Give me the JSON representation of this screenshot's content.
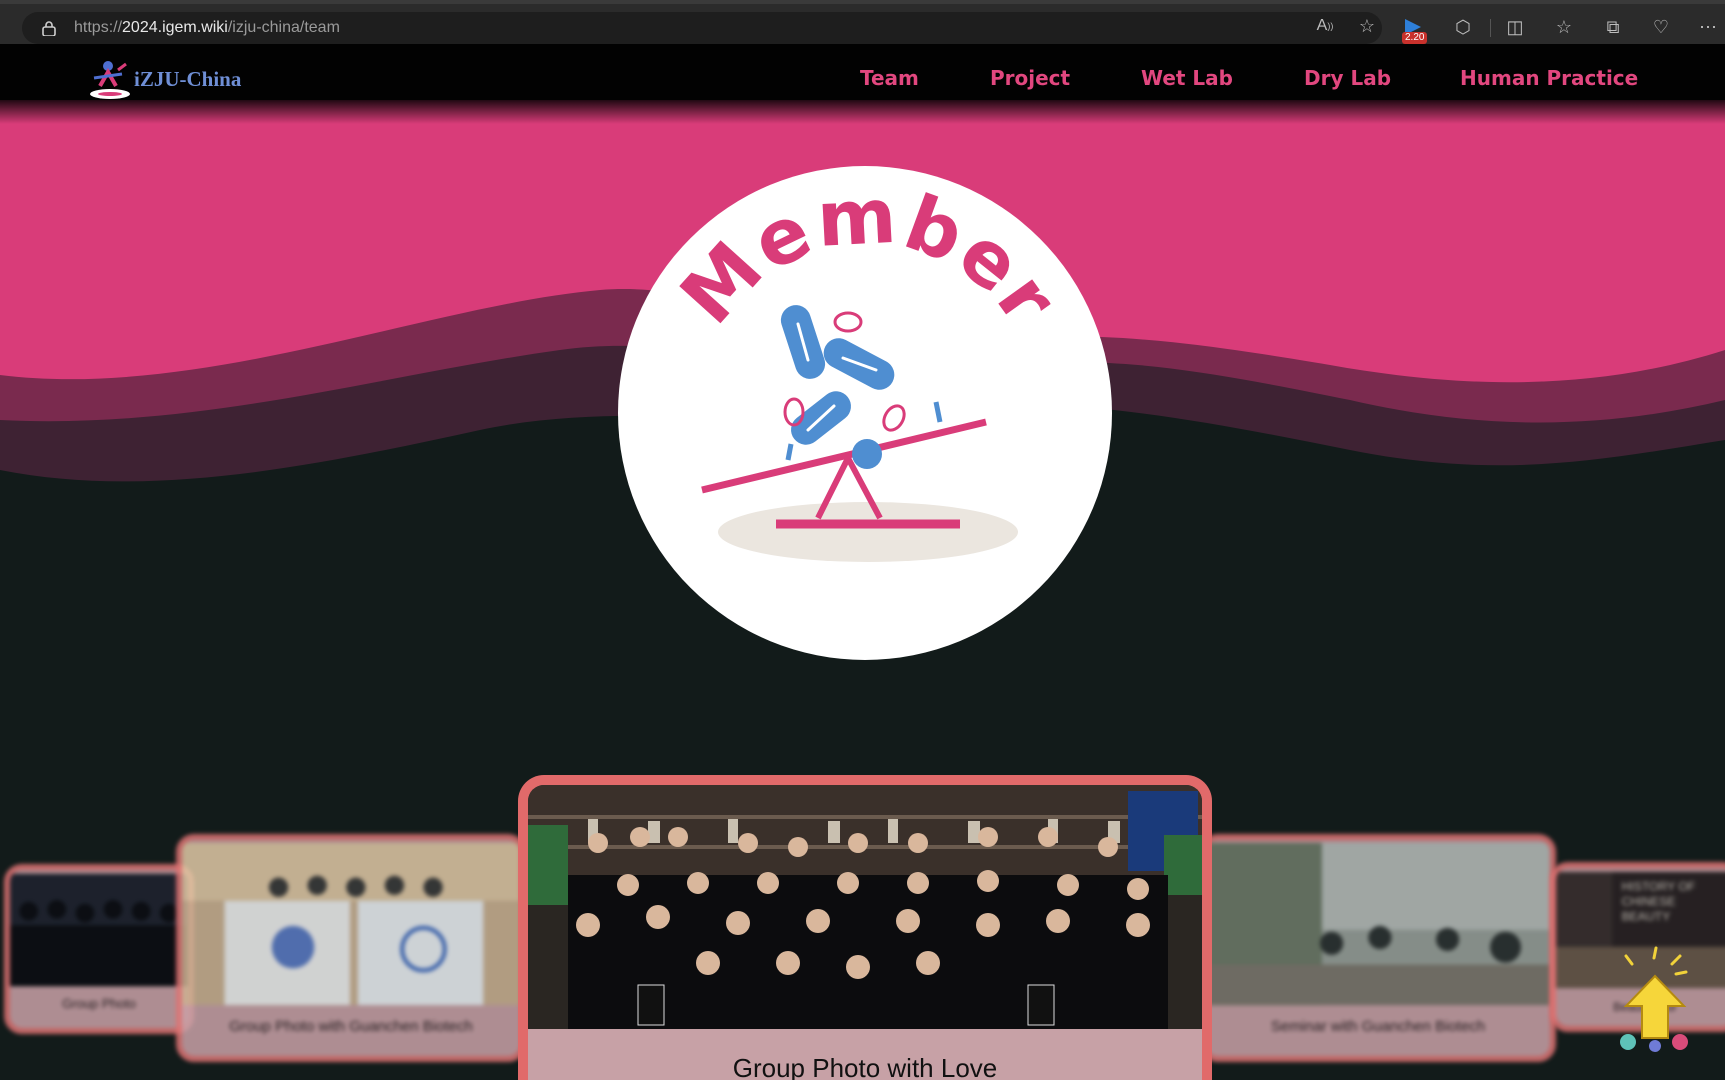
{
  "browser": {
    "url_scheme": "https://",
    "url_host": "2024.igem.wiki",
    "url_path": "/izju-china/team",
    "extension_badge": "2.20",
    "icons": [
      "lock-icon",
      "read-aloud-icon",
      "favorite-star-icon",
      "extension-icon",
      "extensions-puzzle-icon",
      "split-screen-icon",
      "favorites-icon",
      "collections-icon",
      "browser-essentials-icon",
      "more-menu-icon"
    ]
  },
  "site": {
    "logo_text": "iZJU-China",
    "nav": [
      "Team",
      "Project",
      "Wet Lab",
      "Dry Lab",
      "Human Practice"
    ]
  },
  "hero": {
    "badge_text": "Member",
    "colors": {
      "pink": "#d93c79",
      "mid_pink": "#a52f5e",
      "dark_wave": "#6a2a45",
      "blue": "#4f8ed1",
      "bg": "#121b1a"
    }
  },
  "carousel": {
    "items": [
      {
        "caption": "Group Photo"
      },
      {
        "caption": "Group Photo with Guanchen Biotech"
      },
      {
        "caption": "Group Photo with Love"
      },
      {
        "caption": "Seminar with Guanchen Biotech"
      },
      {
        "caption": "Beauty Tour"
      }
    ],
    "active_index": 2,
    "accent_border": "#e16a6a"
  }
}
